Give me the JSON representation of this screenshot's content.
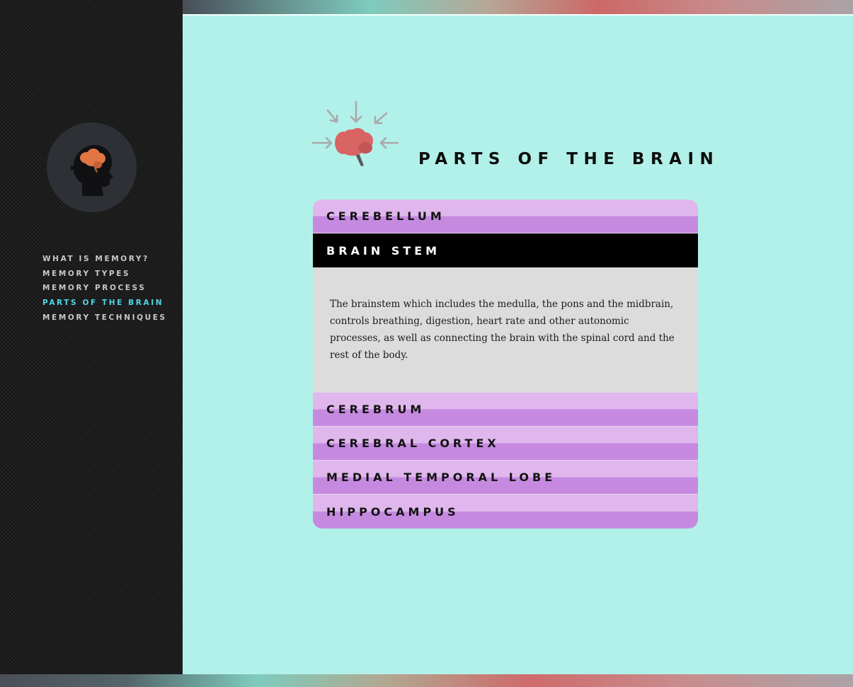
{
  "sidebar": {
    "logo_icon": "head-with-brain-icon",
    "nav": [
      {
        "label": "WHAT IS MEMORY?",
        "active": false
      },
      {
        "label": "MEMORY TYPES",
        "active": false
      },
      {
        "label": "MEMORY PROCESS",
        "active": false
      },
      {
        "label": "PARTS OF THE BRAIN",
        "active": true
      },
      {
        "label": "MEMORY TECHNIQUES",
        "active": false
      }
    ],
    "active_color": "#4fd8e6"
  },
  "main": {
    "header_icon": "brain-arrows-icon",
    "title": "PARTS OF THE BRAIN",
    "accordion": [
      {
        "label": "CEREBELLUM",
        "open": false
      },
      {
        "label": "BRAIN STEM",
        "open": true,
        "content": "The brainstem which includes the medulla, the pons and the midbrain, controls breathing, digestion, heart rate and other autonomic processes, as well as connecting the brain with the spinal cord and the rest of the body."
      },
      {
        "label": "CEREBRUM",
        "open": false
      },
      {
        "label": "CEREBRAL CORTEX",
        "open": false
      },
      {
        "label": "MEDIAL TEMPORAL LOBE",
        "open": false
      },
      {
        "label": "HIPPOCAMPUS",
        "open": false
      }
    ]
  },
  "colors": {
    "background": "#b2f1e9",
    "sidebar": "#1c1c1c",
    "accordion_header": "#c58ae0",
    "accordion_open": "#000000",
    "accordion_body": "#dcdcdc"
  }
}
